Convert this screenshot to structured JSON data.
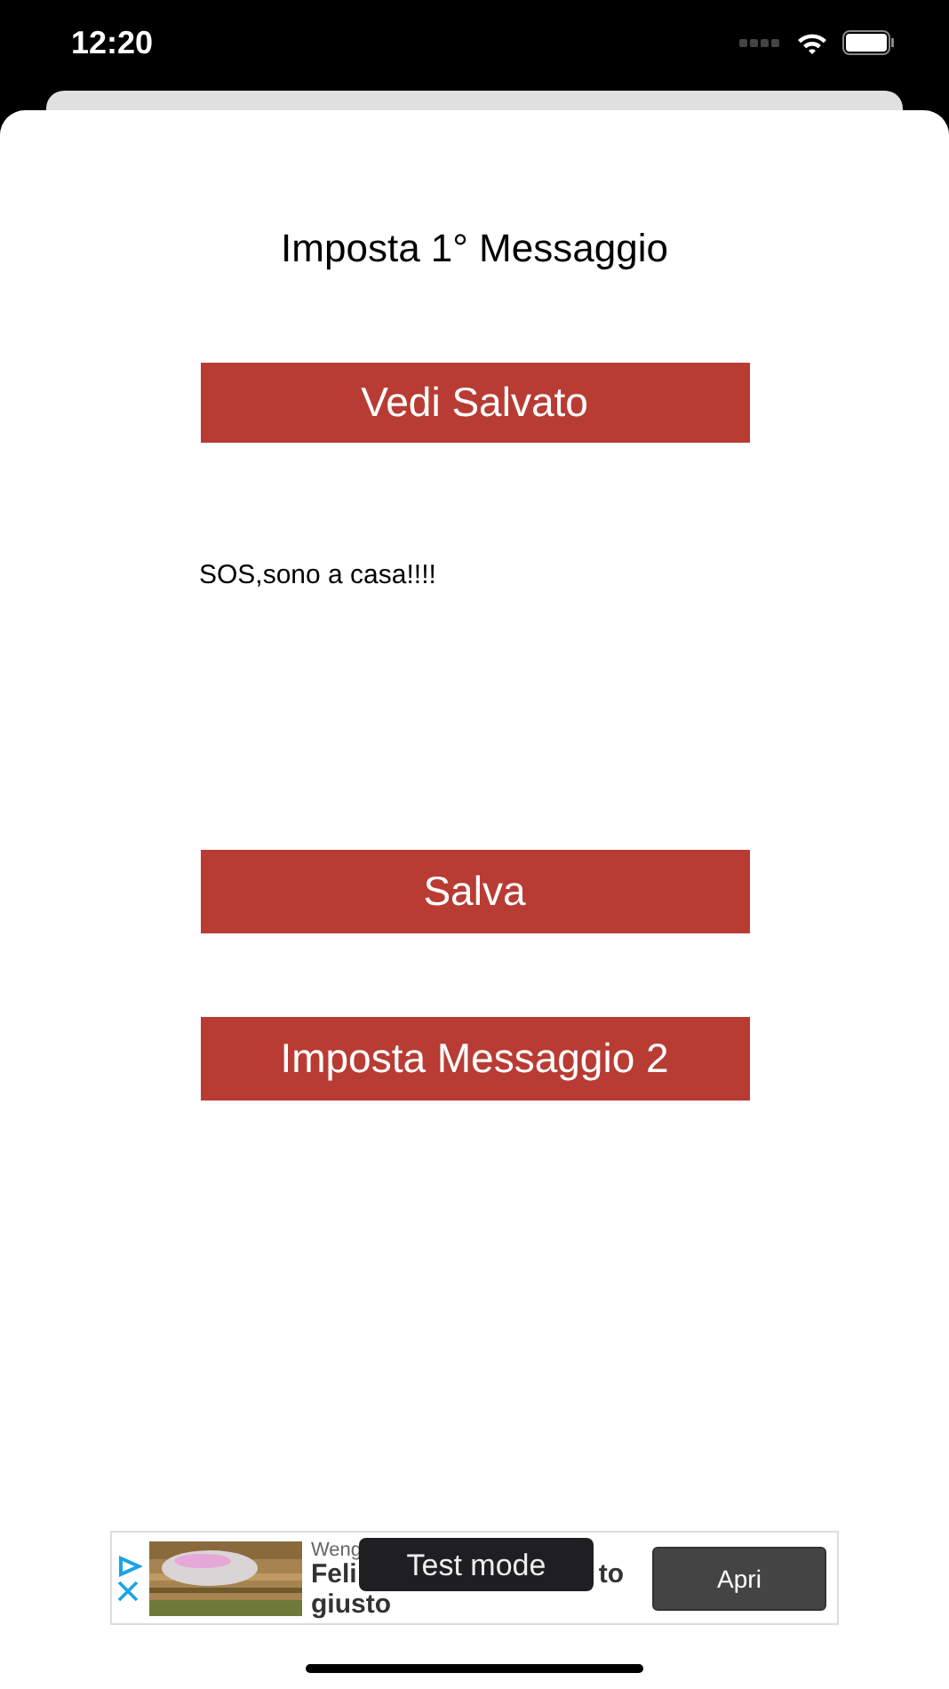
{
  "status_bar": {
    "time": "12:20"
  },
  "title": "Imposta 1° Messaggio",
  "buttons": [
    {
      "label": "Vedi Salvato"
    },
    {
      "label": "Salva"
    },
    {
      "label": "Imposta Messaggio 2"
    }
  ],
  "message": "SOS,sono a casa!!!!",
  "ad": {
    "kind": "picture",
    "advertiser": "Weng",
    "headline_parts": [
      "Feli",
      "to"
    ],
    "headline_line2": "giusto",
    "cta": "Apri"
  },
  "toast": "Test mode"
}
